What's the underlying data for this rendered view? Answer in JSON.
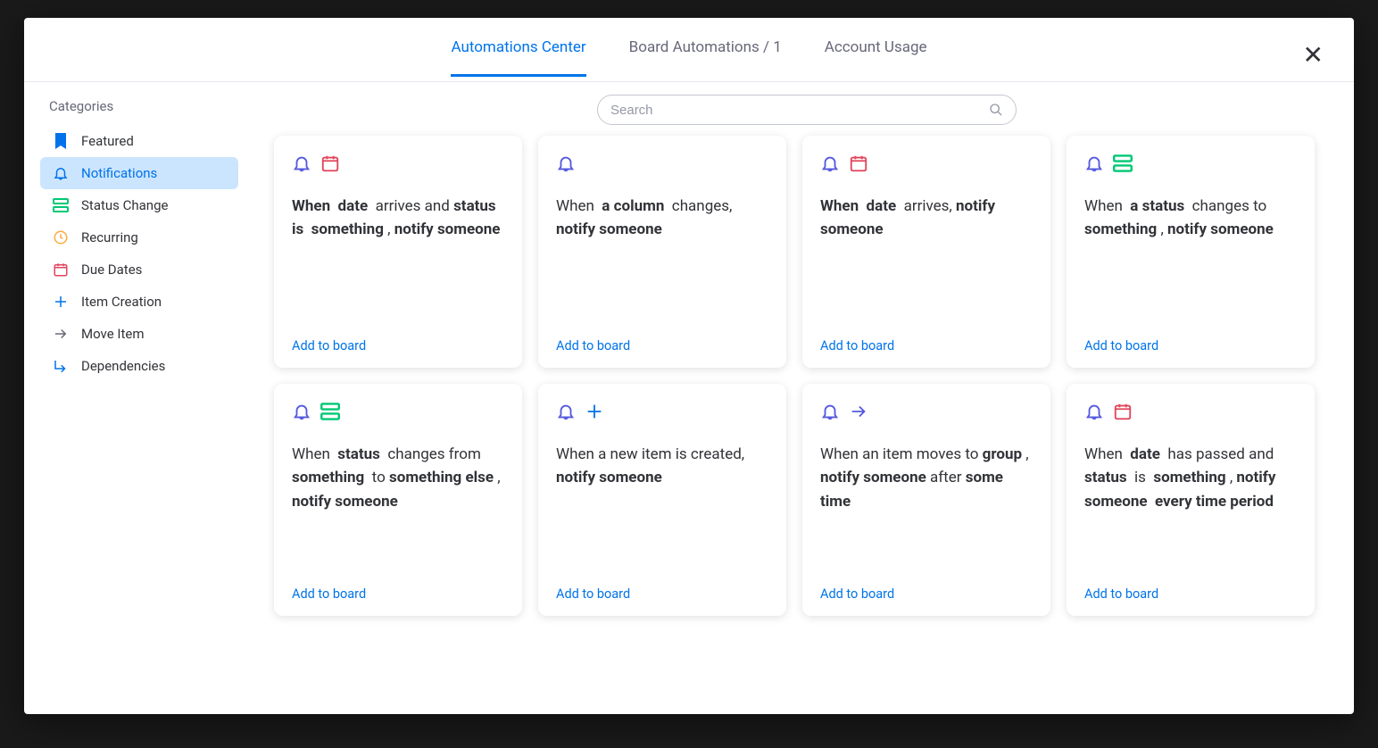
{
  "tabs": {
    "0": {
      "label": "Automations Center"
    },
    "1": {
      "label": "Board Automations / 1"
    },
    "2": {
      "label": "Account Usage"
    }
  },
  "active_tab": 0,
  "search": {
    "placeholder": "Search"
  },
  "sidebar": {
    "title": "Categories",
    "items": {
      "0": {
        "label": "Featured",
        "icon": "bookmark",
        "color": "c-blue"
      },
      "1": {
        "label": "Notifications",
        "icon": "bell",
        "color": "c-purple",
        "active": true
      },
      "2": {
        "label": "Status Change",
        "icon": "status",
        "color": "c-green"
      },
      "3": {
        "label": "Recurring",
        "icon": "recurring",
        "color": "c-orange"
      },
      "4": {
        "label": "Due Dates",
        "icon": "calendar",
        "color": "c-pink"
      },
      "5": {
        "label": "Item Creation",
        "icon": "plus",
        "color": "c-blue"
      },
      "6": {
        "label": "Move Item",
        "icon": "arrow",
        "color": "c-grey"
      },
      "7": {
        "label": "Dependencies",
        "icon": "dependency",
        "color": "c-blue"
      }
    }
  },
  "section_ghost": "",
  "add_to_board_label": "Add to board",
  "cards": {
    "0": {
      "icons": [
        "bell",
        "calendar"
      ],
      "html": "<b>When</b>&nbsp; <b>date</b>&nbsp; arrives and <b>status</b>&nbsp; <b>is</b>&nbsp; <b>something</b> , <b>notify someone</b>"
    },
    "1": {
      "icons": [
        "bell"
      ],
      "html": "When&nbsp; <b>a column</b>&nbsp; changes, <b>notify someone</b>"
    },
    "2": {
      "icons": [
        "bell",
        "calendar"
      ],
      "html": "<b>When</b>&nbsp; <b>date</b>&nbsp; arrives, <b>notify someone</b>"
    },
    "3": {
      "icons": [
        "bell",
        "status"
      ],
      "html": "When&nbsp; <b>a status</b>&nbsp; changes to <b>something</b> , <b>notify someone</b>"
    },
    "4": {
      "icons": [
        "bell",
        "status"
      ],
      "html": "When&nbsp; <b>status</b>&nbsp; changes from <b>something</b>&nbsp; to <b>something else</b> , <b>notify someone</b>"
    },
    "5": {
      "icons": [
        "bell",
        "plus"
      ],
      "html": "When a new item is created, <b>notify someone</b>"
    },
    "6": {
      "icons": [
        "bell",
        "arrow"
      ],
      "html": "When an item moves to <b>group</b> , <b>notify someone</b> after <b>some time</b>"
    },
    "7": {
      "icons": [
        "bell",
        "calendar"
      ],
      "html": "When&nbsp; <b>date</b>&nbsp; has passed and <b>status</b>&nbsp; is&nbsp; <b>something</b> , <b>notify someone</b>&nbsp; <b>every time period</b>"
    }
  }
}
